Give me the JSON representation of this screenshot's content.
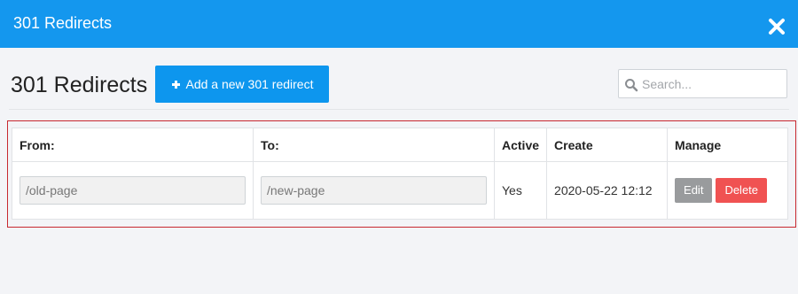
{
  "window": {
    "title": "301 Redirects"
  },
  "header": {
    "heading": "301 Redirects",
    "add_button_label": "Add a new 301 redirect",
    "search_placeholder": "Search..."
  },
  "table": {
    "columns": {
      "from": "From:",
      "to": "To:",
      "active": "Active",
      "create": "Create",
      "manage": "Manage"
    },
    "rows": [
      {
        "from": "/old-page",
        "to": "/new-page",
        "active": "Yes",
        "create": "2020-05-22 12:12",
        "edit_label": "Edit",
        "delete_label": "Delete"
      }
    ]
  },
  "icons": {
    "close": "close-icon",
    "plus": "plus-icon",
    "search": "search-icon"
  },
  "colors": {
    "titlebar": "#1497ee",
    "primary_button": "#0d96ee",
    "edit_button": "#999b9d",
    "delete_button": "#f05252",
    "highlight_border": "#c7282f"
  }
}
